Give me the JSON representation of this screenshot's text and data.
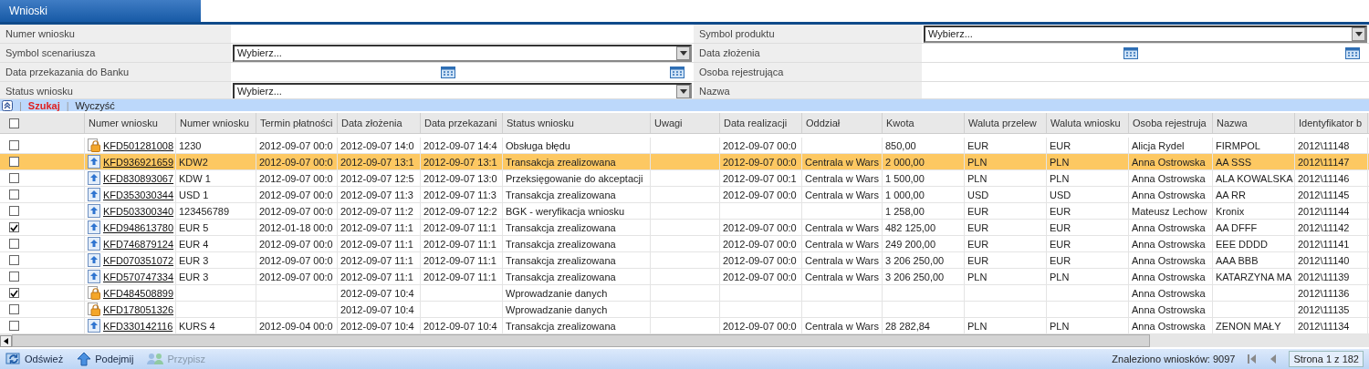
{
  "tabs": [
    {
      "label": "Wnioski",
      "selected": true
    }
  ],
  "filters": [
    {
      "label": "Numer wniosku",
      "kind": "text"
    },
    {
      "label": "Symbol produktu",
      "kind": "select",
      "value": "Wybierz..."
    },
    {
      "label": "Symbol scenariusza",
      "kind": "select",
      "value": "Wybierz..."
    },
    {
      "label": "Data złożenia",
      "kind": "daterange"
    },
    {
      "label": "Data przekazania do Banku",
      "kind": "daterange"
    },
    {
      "label": "Osoba rejestrująca",
      "kind": "text"
    },
    {
      "label": "Status wniosku",
      "kind": "select",
      "value": "Wybierz..."
    },
    {
      "label": "Nazwa",
      "kind": "text"
    }
  ],
  "search_bar": {
    "separators": [
      "|",
      "|"
    ],
    "search": "Szukaj",
    "clear": "Wyczyść"
  },
  "table": {
    "columns": [
      "Numer wniosku",
      "Numer wniosku",
      "Termin płatności",
      "Data złożenia",
      "Data przekazani",
      "Status wniosku",
      "Uwagi",
      "Data realizacji",
      "Oddział",
      "Kwota",
      "Waluta przelew",
      "Waluta wniosku",
      "Osoba rejestruja",
      "Nazwa",
      "Identyfikator b"
    ],
    "all_checked": false,
    "rows": [
      {
        "checked": false,
        "selected": false,
        "kind": "locked",
        "cells": [
          "KFD501281008",
          "1230",
          "2012-09-07 00:0",
          "2012-09-07 14:0",
          "2012-09-07 14:4",
          "Obsługa błędu",
          "",
          "2012-09-07 00:0",
          "",
          "850,00",
          "EUR",
          "EUR",
          "Alicja Rydel",
          "FIRMPOL",
          "2012\\11148"
        ]
      },
      {
        "checked": false,
        "selected": true,
        "kind": "sent",
        "cells": [
          "KFD936921659",
          "KDW2",
          "2012-09-07 00:0",
          "2012-09-07 13:1",
          "2012-09-07 13:1",
          "Transakcja zrealizowana",
          "",
          "2012-09-07 00:0",
          "Centrala w Wars",
          "2 000,00",
          "PLN",
          "PLN",
          "Anna Ostrowska",
          "AA SSS",
          "2012\\11147"
        ]
      },
      {
        "checked": false,
        "selected": false,
        "kind": "sent",
        "cells": [
          "KFD830893067",
          "KDW 1",
          "2012-09-07 00:0",
          "2012-09-07 12:5",
          "2012-09-07 13:0",
          "Przeksięgowanie do akceptacji",
          "",
          "2012-09-07 00:1",
          "Centrala w Wars",
          "1 500,00",
          "PLN",
          "PLN",
          "Anna Ostrowska",
          "ALA KOWALSKA",
          "2012\\11146"
        ]
      },
      {
        "checked": false,
        "selected": false,
        "kind": "sent",
        "cells": [
          "KFD353030344",
          "USD 1",
          "2012-09-07 00:0",
          "2012-09-07 11:3",
          "2012-09-07 11:3",
          "Transakcja zrealizowana",
          "",
          "2012-09-07 00:0",
          "Centrala w Wars",
          "1 000,00",
          "USD",
          "USD",
          "Anna Ostrowska",
          "AA RR",
          "2012\\11145"
        ]
      },
      {
        "checked": false,
        "selected": false,
        "kind": "sent",
        "cells": [
          "KFD503300340",
          "123456789",
          "2012-09-07 00:0",
          "2012-09-07 11:2",
          "2012-09-07 12:2",
          "BGK - weryfikacja wniosku",
          "",
          "",
          "",
          "1 258,00",
          "EUR",
          "EUR",
          "Mateusz Lechow",
          "Kronix",
          "2012\\11144"
        ]
      },
      {
        "checked": true,
        "selected": false,
        "kind": "sent",
        "cells": [
          "KFD948613780",
          "EUR 5",
          "2012-01-18 00:0",
          "2012-09-07 11:1",
          "2012-09-07 11:1",
          "Transakcja zrealizowana",
          "",
          "2012-09-07 00:0",
          "Centrala w Wars",
          "482 125,00",
          "EUR",
          "EUR",
          "Anna Ostrowska",
          "AA DFFF",
          "2012\\11142"
        ]
      },
      {
        "checked": false,
        "selected": false,
        "kind": "sent",
        "cells": [
          "KFD746879124",
          "EUR 4",
          "2012-09-07 00:0",
          "2012-09-07 11:1",
          "2012-09-07 11:1",
          "Transakcja zrealizowana",
          "",
          "2012-09-07 00:0",
          "Centrala w Wars",
          "249 200,00",
          "EUR",
          "EUR",
          "Anna Ostrowska",
          "EEE DDDD",
          "2012\\11141"
        ]
      },
      {
        "checked": false,
        "selected": false,
        "kind": "sent",
        "cells": [
          "KFD070351072",
          "EUR 3",
          "2012-09-07 00:0",
          "2012-09-07 11:1",
          "2012-09-07 11:1",
          "Transakcja zrealizowana",
          "",
          "2012-09-07 00:0",
          "Centrala w Wars",
          "3 206 250,00",
          "EUR",
          "EUR",
          "Anna Ostrowska",
          "AAA BBB",
          "2012\\11140"
        ]
      },
      {
        "checked": false,
        "selected": false,
        "kind": "sent",
        "cells": [
          "KFD570747334",
          "EUR 3",
          "2012-09-07 00:0",
          "2012-09-07 11:1",
          "2012-09-07 11:1",
          "Transakcja zrealizowana",
          "",
          "2012-09-07 00:0",
          "Centrala w Wars",
          "3 206 250,00",
          "PLN",
          "PLN",
          "Anna Ostrowska",
          "KATARZYNA MA",
          "2012\\11139"
        ]
      },
      {
        "checked": true,
        "selected": false,
        "kind": "locked",
        "cells": [
          "KFD484508899",
          "",
          "",
          "2012-09-07 10:4",
          "",
          "Wprowadzanie danych",
          "",
          "",
          "",
          "",
          "",
          "",
          "Anna Ostrowska",
          "",
          "2012\\11136"
        ]
      },
      {
        "checked": false,
        "selected": false,
        "kind": "locked",
        "cells": [
          "KFD178051326",
          "",
          "",
          "2012-09-07 10:4",
          "",
          "Wprowadzanie danych",
          "",
          "",
          "",
          "",
          "",
          "",
          "Anna Ostrowska",
          "",
          "2012\\11135"
        ]
      },
      {
        "checked": false,
        "selected": false,
        "kind": "sent",
        "cells": [
          "KFD330142116",
          "KURS 4",
          "2012-09-04 00:0",
          "2012-09-07 10:4",
          "2012-09-07 10:4",
          "Transakcja zrealizowana",
          "",
          "2012-09-07 00:0",
          "Centrala w Wars",
          "28 282,84",
          "PLN",
          "PLN",
          "Anna Ostrowska",
          "ZENON MAŁY",
          "2012\\11134"
        ]
      }
    ]
  },
  "footer": {
    "actions": [
      {
        "label": "Odśwież",
        "kind": "refresh",
        "disabled": false
      },
      {
        "label": "Podejmij",
        "kind": "take",
        "disabled": false
      },
      {
        "label": "Przypisz",
        "kind": "assign",
        "disabled": true
      }
    ],
    "found": "Znaleziono wniosków: 9097",
    "page": "Strona 1 z 182"
  }
}
